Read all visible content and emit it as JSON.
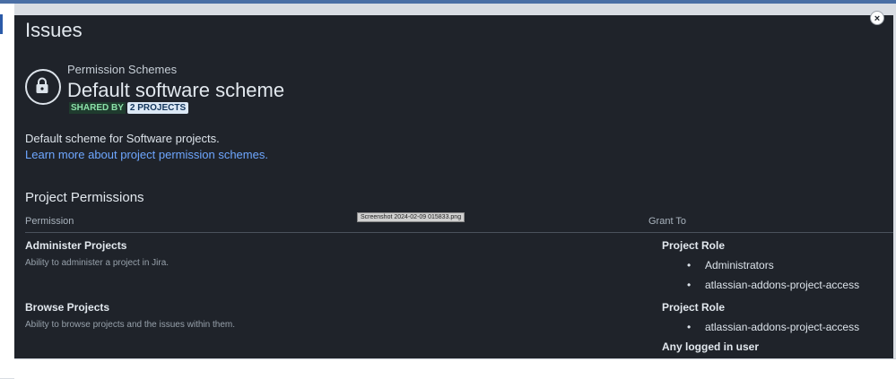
{
  "page": {
    "title": "Issues"
  },
  "scheme": {
    "breadcrumb": "Permission Schemes",
    "name": "Default software scheme",
    "shared_by_label": "SHARED BY",
    "projects_link": "2 PROJECTS",
    "description": "Default scheme for Software projects.",
    "learn_more": "Learn more about project permission schemes."
  },
  "permissions_section": {
    "title": "Project Permissions",
    "col_permission": "Permission",
    "col_grant": "Grant To",
    "rows": [
      {
        "name": "Administer Projects",
        "description": "Ability to administer a project in Jira.",
        "grant_role": "Project Role",
        "grant_items": [
          "Administrators",
          "atlassian-addons-project-access"
        ]
      },
      {
        "name": "Browse Projects",
        "description": "Ability to browse projects and the issues within them.",
        "grant_role": "Project Role",
        "grant_items": [
          "atlassian-addons-project-access"
        ],
        "extra_grant": "Any logged in user"
      }
    ]
  },
  "tooltip": "Screenshot 2024-02-09 015833.png",
  "icons": {
    "lock": "lock-icon",
    "close": "close-icon"
  },
  "colors": {
    "panel_bg": "#1f232a",
    "link": "#6ea7ff",
    "shared_badge": "#8be0a8"
  }
}
